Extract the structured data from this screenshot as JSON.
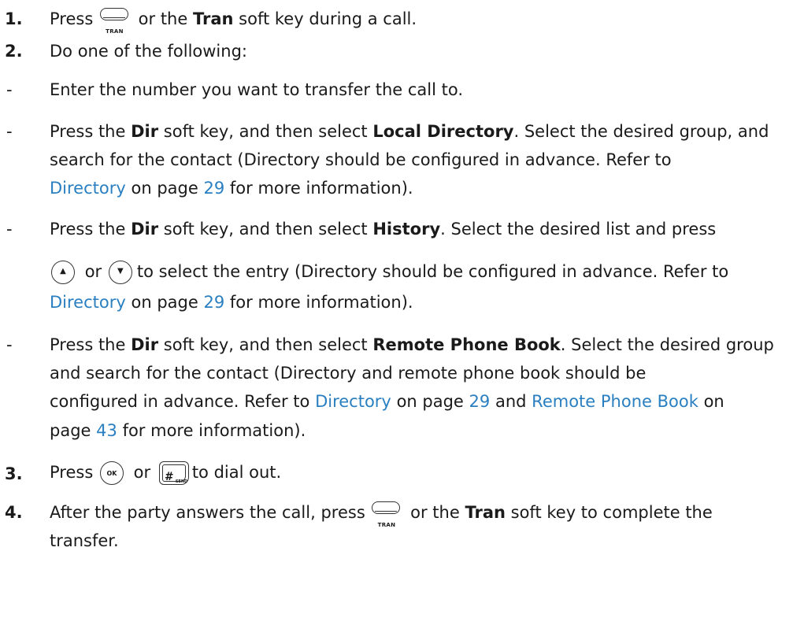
{
  "steps": {
    "s1": {
      "num": "1.",
      "t1": "Press",
      "key_label": "TRAN",
      "t2": "or the",
      "b1": "Tran",
      "t3": "soft key during a call."
    },
    "s2": {
      "num": "2.",
      "t1": "Do one of the following:"
    },
    "s3": {
      "num": "3.",
      "t1": "Press",
      "ok_label": "OK",
      "t2": "or",
      "hash_glyph": "#",
      "hash_label": "SEND",
      "t3": "to dial out."
    },
    "s4": {
      "num": "4.",
      "t1": "After the party answers the call, press",
      "key_label": "TRAN",
      "t2": "or the",
      "b1": "Tran",
      "t3": "soft key to complete the",
      "t4": "transfer."
    }
  },
  "options": {
    "dash": "-",
    "o1": {
      "t1": "Enter the number you want to transfer the call to."
    },
    "o2": {
      "t1": "Press the",
      "b1": "Dir",
      "t2": "soft key, and then select",
      "b2": "Local Directory",
      "t3": ". Select the desired group, and",
      "t4": "search for the contact (Directory should be configured in advance. Refer to",
      "link1": "Directory",
      "t5": "on page",
      "link2": "29",
      "t6": "for more information)."
    },
    "o3": {
      "t1": "Press the",
      "b1": "Dir",
      "t2": "soft key, and then select",
      "b2": "History",
      "t3": ". Select the desired list and press",
      "up_glyph": "▲",
      "t4": "or",
      "down_glyph": "▼",
      "t5": "to select the entry (Directory should be configured in advance. Refer to",
      "link1": "Directory",
      "t6": "on page",
      "link2": "29",
      "t7": "for more information)."
    },
    "o4": {
      "t1": "Press the",
      "b1": "Dir",
      "t2": "soft key, and then select",
      "b2": "Remote Phone Book",
      "t3": ". Select the desired group",
      "t4": "and search for the contact (Directory and remote phone book should be",
      "t5": "configured in advance. Refer to",
      "link1": "Directory",
      "t6": "on page",
      "link2": "29",
      "t7": "and",
      "link3": "Remote Phone Book",
      "t8": "on",
      "t9": "page",
      "link4": "43",
      "t10": "for more information)."
    }
  },
  "colors": {
    "link": "#2a7fc0",
    "text": "#1a1a1a"
  }
}
